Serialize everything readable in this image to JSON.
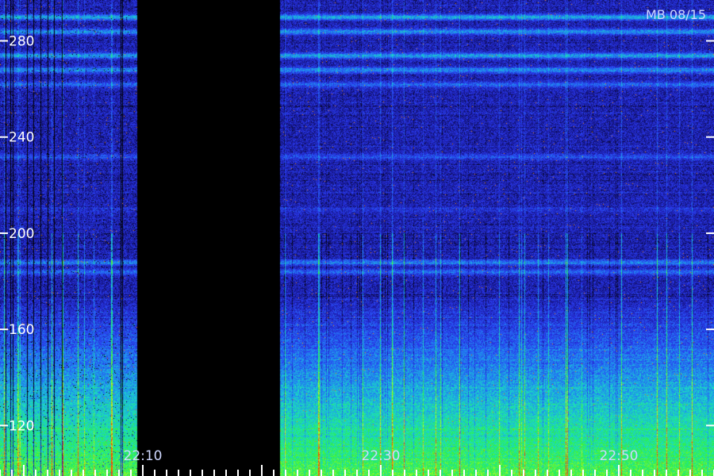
{
  "stamp": "MB 08/15",
  "chart_data": {
    "type": "heatmap",
    "title": "",
    "xlabel": "",
    "ylabel": "",
    "y": {
      "ticks": [
        120,
        160,
        200,
        240,
        280
      ],
      "tick_labels": [
        "120",
        "160",
        "200",
        "240",
        "280"
      ],
      "range": [
        99,
        297
      ]
    },
    "x": {
      "ticks": [
        "22:10",
        "22:30",
        "22:50"
      ],
      "tick_labels": [
        "22:10",
        "22:30",
        "22:50"
      ],
      "range": [
        "21:58",
        "22:58"
      ]
    },
    "data_gap": {
      "from": "22:09.5",
      "to": "22:21.5"
    },
    "colormap": [
      "#000000",
      "#1a1aa0",
      "#2a3cf0",
      "#1f8ff0",
      "#1ae0c0",
      "#30f040",
      "#c8ff20",
      "#ff4000"
    ],
    "colors": {
      "label": "#ffffff",
      "stamp": "#cfd8ff",
      "background": "#000000"
    }
  }
}
